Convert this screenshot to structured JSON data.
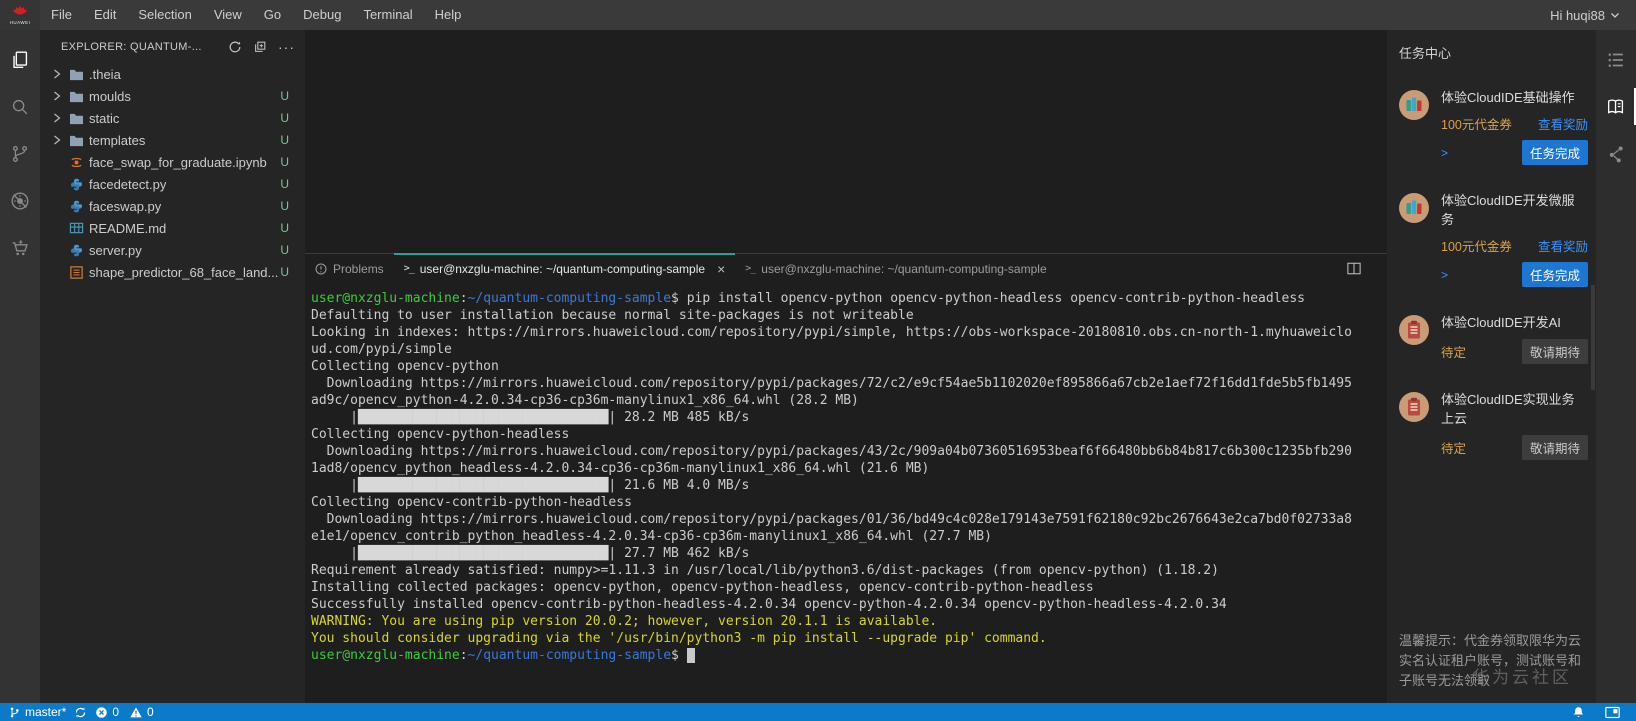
{
  "menubar": {
    "items": [
      "File",
      "Edit",
      "Selection",
      "View",
      "Go",
      "Debug",
      "Terminal",
      "Help"
    ],
    "user_label": "Hi huqi88"
  },
  "activity_left": [
    {
      "icon": "files-icon",
      "active": true
    },
    {
      "icon": "search-icon",
      "active": false
    },
    {
      "icon": "source-control-icon",
      "active": false
    },
    {
      "icon": "debug-icon",
      "active": false
    },
    {
      "icon": "extensions-icon",
      "active": false
    }
  ],
  "activity_right": [
    {
      "icon": "task-list-icon",
      "active": false
    },
    {
      "icon": "handbook-icon",
      "active": true
    },
    {
      "icon": "share-icon",
      "active": false
    }
  ],
  "explorer": {
    "title": "EXPLORER: QUANTUM-...",
    "tree": [
      {
        "label": ".theia",
        "type": "folder",
        "badge": ""
      },
      {
        "label": "moulds",
        "type": "folder",
        "badge": "U"
      },
      {
        "label": "static",
        "type": "folder",
        "badge": "U"
      },
      {
        "label": "templates",
        "type": "folder",
        "badge": "U"
      },
      {
        "label": "face_swap_for_graduate.ipynb",
        "type": "ipynb",
        "badge": "U"
      },
      {
        "label": "facedetect.py",
        "type": "py",
        "badge": "U"
      },
      {
        "label": "faceswap.py",
        "type": "py",
        "badge": "U"
      },
      {
        "label": "README.md",
        "type": "md",
        "badge": "U"
      },
      {
        "label": "server.py",
        "type": "py",
        "badge": "U"
      },
      {
        "label": "shape_predictor_68_face_land...",
        "type": "dat",
        "badge": "U"
      }
    ]
  },
  "panel": {
    "tabs": [
      {
        "type": "problems",
        "label": "Problems",
        "active": false,
        "closable": false
      },
      {
        "type": "terminal",
        "label": "user@nxzglu-machine: ~/quantum-computing-sample",
        "active": true,
        "closable": true
      },
      {
        "type": "terminal",
        "label": "user@nxzglu-machine: ~/quantum-computing-sample",
        "active": false,
        "closable": false
      }
    ]
  },
  "terminal": {
    "lines": [
      {
        "segs": [
          [
            "green",
            "user@nxzglu-machine"
          ],
          [
            "plain",
            ":"
          ],
          [
            "blue",
            "~/quantum-computing-sample"
          ],
          [
            "plain",
            "$ pip install opencv-python opencv-python-headless opencv-contrib-python-headless"
          ]
        ]
      },
      {
        "segs": [
          [
            "plain",
            "Defaulting to user installation because normal site-packages is not writeable"
          ]
        ]
      },
      {
        "segs": [
          [
            "plain",
            "Looking in indexes: https://mirrors.huaweicloud.com/repository/pypi/simple, https://obs-workspace-20180810.obs.cn-north-1.myhuaweiclo"
          ]
        ]
      },
      {
        "segs": [
          [
            "plain",
            "ud.com/pypi/simple"
          ]
        ]
      },
      {
        "segs": [
          [
            "plain",
            "Collecting opencv-python"
          ]
        ]
      },
      {
        "segs": [
          [
            "plain",
            "  Downloading https://mirrors.huaweicloud.com/repository/pypi/packages/72/c2/e9cf54ae5b1102020ef895866a67cb2e1aef72f16dd1fde5b5fb1495"
          ]
        ]
      },
      {
        "segs": [
          [
            "plain",
            "ad9c/opencv_python-4.2.0.34-cp36-cp36m-manylinux1_x86_64.whl (28.2 MB)"
          ]
        ]
      },
      {
        "segs": [
          [
            "plain",
            "     |"
          ],
          [
            "bar",
            "████████████████████████████████"
          ],
          [
            "plain",
            "| 28.2 MB 485 kB/s"
          ]
        ]
      },
      {
        "segs": [
          [
            "plain",
            "Collecting opencv-python-headless"
          ]
        ]
      },
      {
        "segs": [
          [
            "plain",
            "  Downloading https://mirrors.huaweicloud.com/repository/pypi/packages/43/2c/909a04b07360516953beaf6f66480bb6b84b817c6b300c1235bfb290"
          ]
        ]
      },
      {
        "segs": [
          [
            "plain",
            "1ad8/opencv_python_headless-4.2.0.34-cp36-cp36m-manylinux1_x86_64.whl (21.6 MB)"
          ]
        ]
      },
      {
        "segs": [
          [
            "plain",
            "     |"
          ],
          [
            "bar",
            "████████████████████████████████"
          ],
          [
            "plain",
            "| 21.6 MB 4.0 MB/s"
          ]
        ]
      },
      {
        "segs": [
          [
            "plain",
            "Collecting opencv-contrib-python-headless"
          ]
        ]
      },
      {
        "segs": [
          [
            "plain",
            "  Downloading https://mirrors.huaweicloud.com/repository/pypi/packages/01/36/bd49c4c028e179143e7591f62180c92bc2676643e2ca7bd0f02733a8"
          ]
        ]
      },
      {
        "segs": [
          [
            "plain",
            "e1e1/opencv_contrib_python_headless-4.2.0.34-cp36-cp36m-manylinux1_x86_64.whl (27.7 MB)"
          ]
        ]
      },
      {
        "segs": [
          [
            "plain",
            "     |"
          ],
          [
            "bar",
            "████████████████████████████████"
          ],
          [
            "plain",
            "| 27.7 MB 462 kB/s"
          ]
        ]
      },
      {
        "segs": [
          [
            "plain",
            "Requirement already satisfied: numpy>=1.11.3 in /usr/local/lib/python3.6/dist-packages (from opencv-python) (1.18.2)"
          ]
        ]
      },
      {
        "segs": [
          [
            "plain",
            "Installing collected packages: opencv-python, opencv-python-headless, opencv-contrib-python-headless"
          ]
        ]
      },
      {
        "segs": [
          [
            "plain",
            "Successfully installed opencv-contrib-python-headless-4.2.0.34 opencv-python-4.2.0.34 opencv-python-headless-4.2.0.34"
          ]
        ]
      },
      {
        "segs": [
          [
            "yellow",
            "WARNING: You are using pip version 20.0.2; however, version 20.1.1 is available."
          ]
        ]
      },
      {
        "segs": [
          [
            "yellow",
            "You should consider upgrading via the '/usr/bin/python3 -m pip install --upgrade pip' command."
          ]
        ]
      },
      {
        "segs": [
          [
            "green",
            "user@nxzglu-machine"
          ],
          [
            "plain",
            ":"
          ],
          [
            "blue",
            "~/quantum-computing-sample"
          ],
          [
            "plain",
            "$ "
          ],
          [
            "cursor",
            ""
          ]
        ]
      }
    ]
  },
  "tasks": {
    "title": "任务中心",
    "cards": [
      {
        "icon": "books-icon",
        "title": "体验CloudIDE基础操作",
        "reward": "100元代金券",
        "reward_link": "查看奖励",
        "expander": ">",
        "action": "任务完成",
        "action_style": "primary"
      },
      {
        "icon": "books-icon",
        "title": "体验CloudIDE开发微服务",
        "reward": "100元代金券",
        "reward_link": "查看奖励",
        "expander": ">",
        "action": "任务完成",
        "action_style": "primary"
      },
      {
        "icon": "clipboard-icon",
        "title": "体验CloudIDE开发AI",
        "reward": "待定",
        "action": "敬请期待",
        "action_style": "disabled"
      },
      {
        "icon": "clipboard-icon",
        "title": "体验CloudIDE实现业务上云",
        "reward": "待定",
        "action": "敬请期待",
        "action_style": "disabled"
      }
    ],
    "note": "温馨提示：代金券领取限华为云实名认证租户账号，测试账号和子账号无法领取",
    "watermark": "华为云社区"
  },
  "statusbar": {
    "branch": "master*",
    "errors": "0",
    "warnings": "0"
  },
  "colors": {
    "statusbar_blue": "#0a7ac9",
    "untracked_green": "#73c991",
    "active_tab_teal": "#2aa198",
    "terminal_warning_yellow": "#d6d62a",
    "reward_orange": "#d9a24d",
    "link_blue": "#3794ff"
  }
}
